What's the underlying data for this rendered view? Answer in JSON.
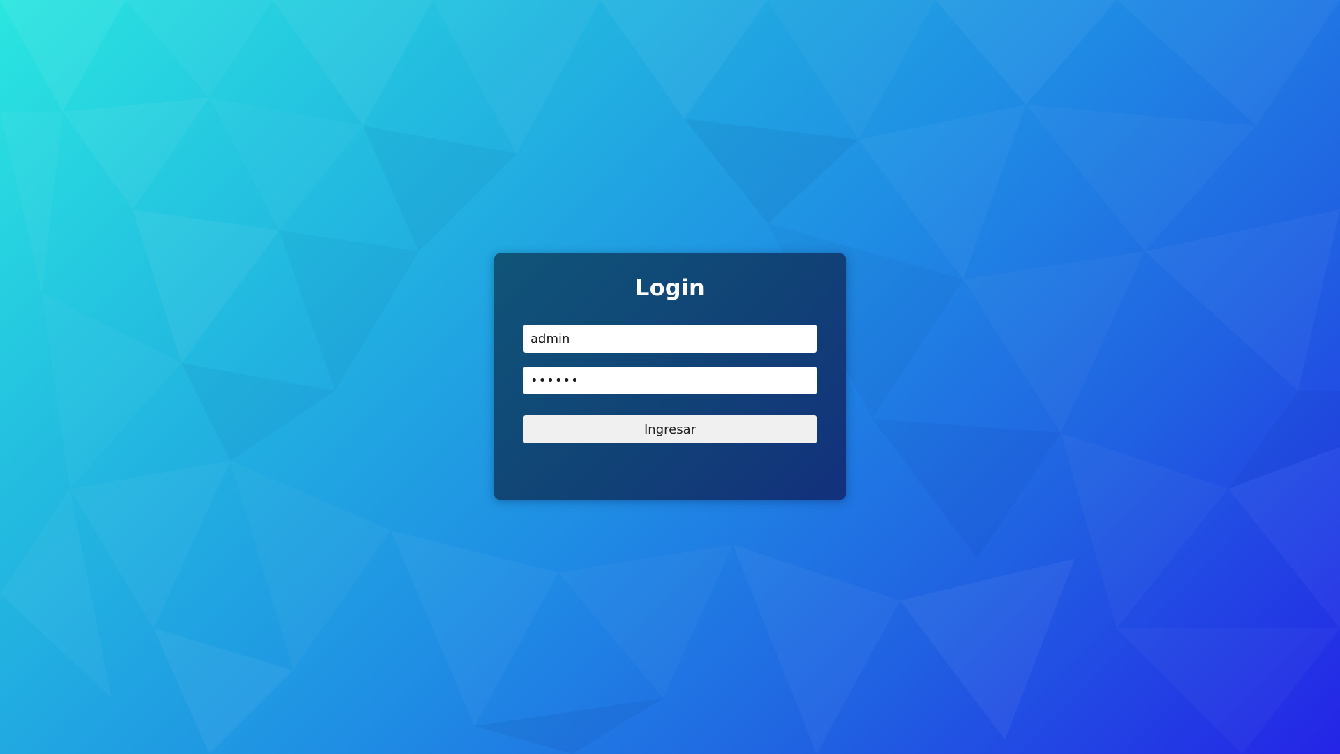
{
  "page": {
    "background_gradient_colors": [
      "#2ae6e0",
      "#22b6e0",
      "#1f8ee4",
      "#2060e2",
      "#2424e6"
    ],
    "card_color": "#103e6c"
  },
  "login": {
    "title": "Login",
    "username_value": "admin",
    "password_value": "••••••",
    "submit_label": "Ingresar"
  }
}
